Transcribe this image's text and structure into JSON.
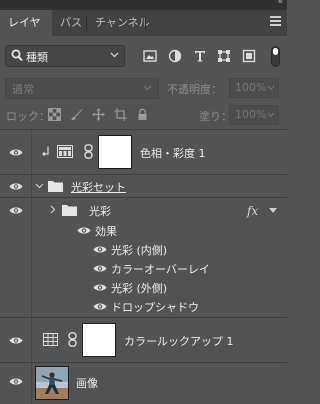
{
  "panel": {
    "collapse_glyph": "«",
    "tabs": [
      {
        "label": "レイヤー",
        "active": true
      },
      {
        "label": "パス",
        "active": false
      },
      {
        "label": "チャンネル",
        "active": false
      }
    ],
    "menu_icon": "hamburger-icon"
  },
  "filter": {
    "kind_label": "種類",
    "icons": [
      "pixel-filter-icon",
      "adjustment-filter-icon",
      "type-filter-icon",
      "shape-filter-icon",
      "smartobject-filter-icon"
    ]
  },
  "blend": {
    "mode": "通常",
    "opacity_label": "不透明度：",
    "opacity_value": "100%",
    "lock_label": "ロック：",
    "fill_label": "塗り：",
    "fill_value": "100%",
    "lock_icons": [
      "lock-transparency-icon",
      "lock-brush-icon",
      "lock-move-icon",
      "lock-artboard-icon",
      "lock-all-icon"
    ]
  },
  "layers": [
    {
      "name": "色相・彩度 1",
      "type": "adjustment",
      "clipped": true
    },
    {
      "name": "光彩セット",
      "type": "group",
      "expanded": true
    },
    {
      "name": "光彩",
      "type": "group",
      "expanded": false,
      "fx": "fx"
    },
    {
      "name": "効果",
      "type": "effects-header"
    },
    {
      "name": "光彩 (内側)",
      "type": "effect"
    },
    {
      "name": "カラーオーバーレイ",
      "type": "effect"
    },
    {
      "name": "光彩 (外側)",
      "type": "effect"
    },
    {
      "name": "ドロップシャドウ",
      "type": "effect"
    },
    {
      "name": "カラールックアップ 1",
      "type": "adjustment"
    },
    {
      "name": "画像",
      "type": "image"
    }
  ],
  "colors": {
    "panel_bg": "#535353",
    "tab_bg": "#424242",
    "text": "#ececec"
  }
}
